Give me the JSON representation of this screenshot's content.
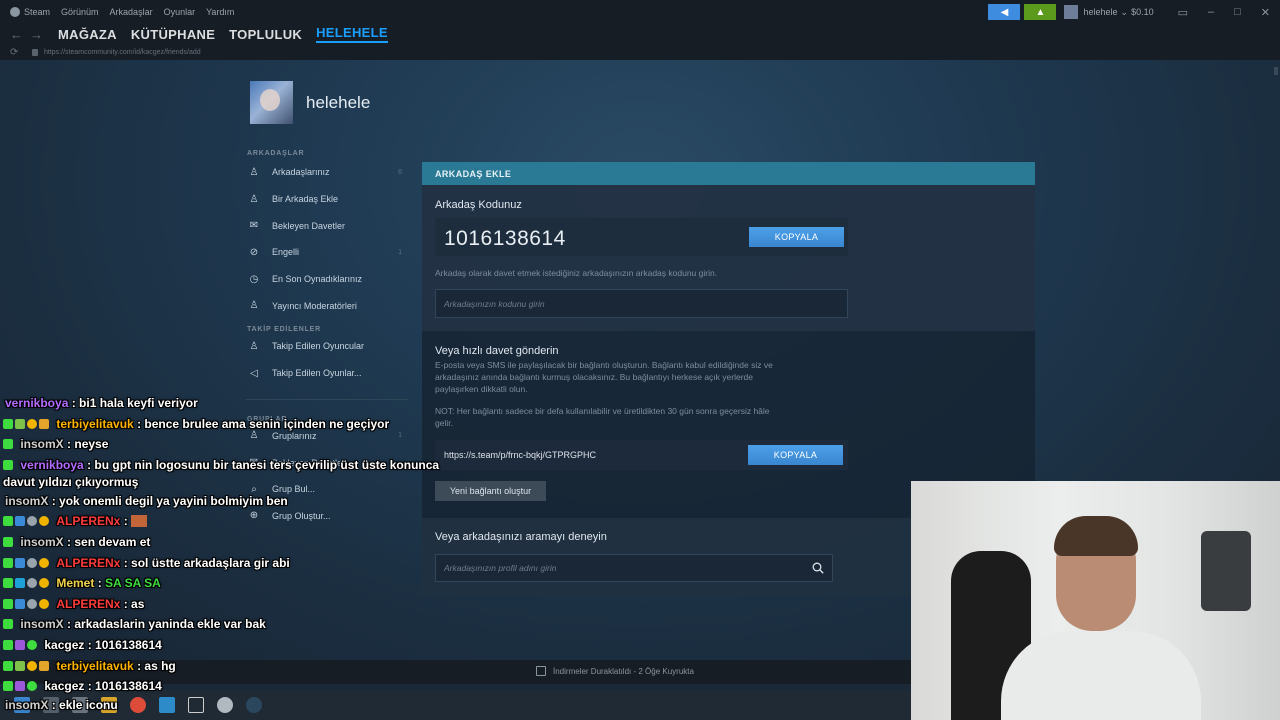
{
  "titlebar": {
    "menu": [
      "Steam",
      "Görünüm",
      "Arkadaşlar",
      "Oyunlar",
      "Yardım"
    ],
    "user": "helehele",
    "balance": "$0.10"
  },
  "nav": {
    "tabs": [
      "MAĞAZA",
      "KÜTÜPHANE",
      "TOPLULUK",
      "HELEHELE"
    ],
    "active_tab": "HELEHELE",
    "url": "https://steamcommunity.com/id/kacgez/friends/add"
  },
  "profile": {
    "name": "helehele"
  },
  "sidebar": {
    "section_friends": "ARKADAŞLAR",
    "friends_items": [
      {
        "label": "Arkadaşlarınız",
        "count": "6",
        "icon": "user-icon"
      },
      {
        "label": "Bir Arkadaş Ekle",
        "count": "",
        "icon": "add-user-icon"
      },
      {
        "label": "Bekleyen Davetler",
        "count": "",
        "icon": "mail-icon"
      },
      {
        "label": "Engelli",
        "count": "1",
        "icon": "blocked-icon"
      },
      {
        "label": "En Son Oynadıklarınız",
        "count": "",
        "icon": "clock-icon"
      },
      {
        "label": "Yayıncı Moderatörleri",
        "count": "",
        "icon": "moderator-icon"
      }
    ],
    "section_following": "TAKİP EDİLENLER",
    "following_items": [
      {
        "label": "Takip Edilen Oyuncular",
        "icon": "user-icon"
      },
      {
        "label": "Takip Edilen Oyunlar...",
        "icon": "megaphone-icon"
      }
    ],
    "section_groups": "GRUPLAR",
    "group_items": [
      {
        "label": "Gruplarınız",
        "count": "1",
        "icon": "group-icon"
      },
      {
        "label": "Bekleyen Davetler",
        "count": "",
        "icon": "mail-icon"
      },
      {
        "label": "Grup Bul...",
        "count": "",
        "icon": "search-icon"
      },
      {
        "label": "Grup Oluştur...",
        "count": "",
        "icon": "plus-circle-icon"
      }
    ]
  },
  "panel": {
    "header": "ARKADAŞ EKLE",
    "code_title": "Arkadaş Kodunuz",
    "friend_code": "1016138614",
    "copy_label": "KOPYALA",
    "code_hint": "Arkadaş olarak davet etmek istediğiniz arkadaşınızın arkadaş kodunu girin.",
    "code_placeholder": "Arkadaşınızın kodunu girin",
    "invite_title": "Veya hızlı davet gönderin",
    "invite_desc_1": "E-posta veya SMS ile paylaşılacak bir bağlantı oluşturun. Bağlantı kabul edildiğinde siz ve",
    "invite_desc_2": "arkadaşınız anında bağlantı kurmuş olacaksınız. Bu bağlantıyı herkese açık yerlerde",
    "invite_desc_3": "paylaşırken dikkatli olun.",
    "invite_note_1": "NOT: Her bağlantı sadece bir defa kullanılabilir ve üretildikten 30 gün sonra geçersiz hâle",
    "invite_note_2": "gelir.",
    "invite_link": "https://s.team/p/frnc-bqkj/GTPRGPHC",
    "new_link_label": "Yeni bağlantı oluştur",
    "search_title": "Veya arkadaşınızı aramayı deneyin",
    "search_placeholder": "Arkadaşınızın profil adını girin"
  },
  "status": {
    "downloads": "İndirmeler Duraklatıldı - 2 Öğe Kuyrukta"
  },
  "chat": [
    {
      "user": "vernikboya",
      "color": "#b36cff",
      "text": ": bi1 hala keyfi veriyor"
    },
    {
      "user": "terbiyelitavuk",
      "color": "#ffb400",
      "text": ": bence brulee ama senin içinden ne geçiyor"
    },
    {
      "user": "insomX",
      "color": "#cfcfcf",
      "text": ": neyse"
    },
    {
      "user": "vernikboya",
      "color": "#b36cff",
      "text": ": bu gpt nin logosunu bir tanesi ters çevrilip üst üste konunca davut yıldızı çıkıyormuş"
    },
    {
      "user": "insomX",
      "color": "#cfcfcf",
      "text": ": yok onemli degil ya yayini bolmiyim ben"
    },
    {
      "user": "ALPERENx",
      "color": "#ff3c3c",
      "text": ":"
    },
    {
      "user": "insomX",
      "color": "#cfcfcf",
      "text": ": sen devam et"
    },
    {
      "user": "ALPERENx",
      "color": "#ff3c3c",
      "text": ": sol üstte arkadaşlara gir abi"
    },
    {
      "user": "Memet",
      "color": "#f0d34a",
      "text": ":",
      "green": "SA  SA  SA"
    },
    {
      "user": "ALPERENx",
      "color": "#ff3c3c",
      "text": ": as"
    },
    {
      "user": "insomX",
      "color": "#cfcfcf",
      "text": ": arkadaslarin yaninda ekle var bak"
    },
    {
      "user": "kacgez",
      "color": "#ffffff",
      "text": ": 1016138614"
    },
    {
      "user": "terbiyelitavuk",
      "color": "#ffb400",
      "text": ": as hg"
    },
    {
      "user": "kacgez",
      "color": "#ffffff",
      "text": ": 1016138614"
    },
    {
      "user": "insomX",
      "color": "#cfcfcf",
      "text": ": ekle iconu"
    }
  ]
}
